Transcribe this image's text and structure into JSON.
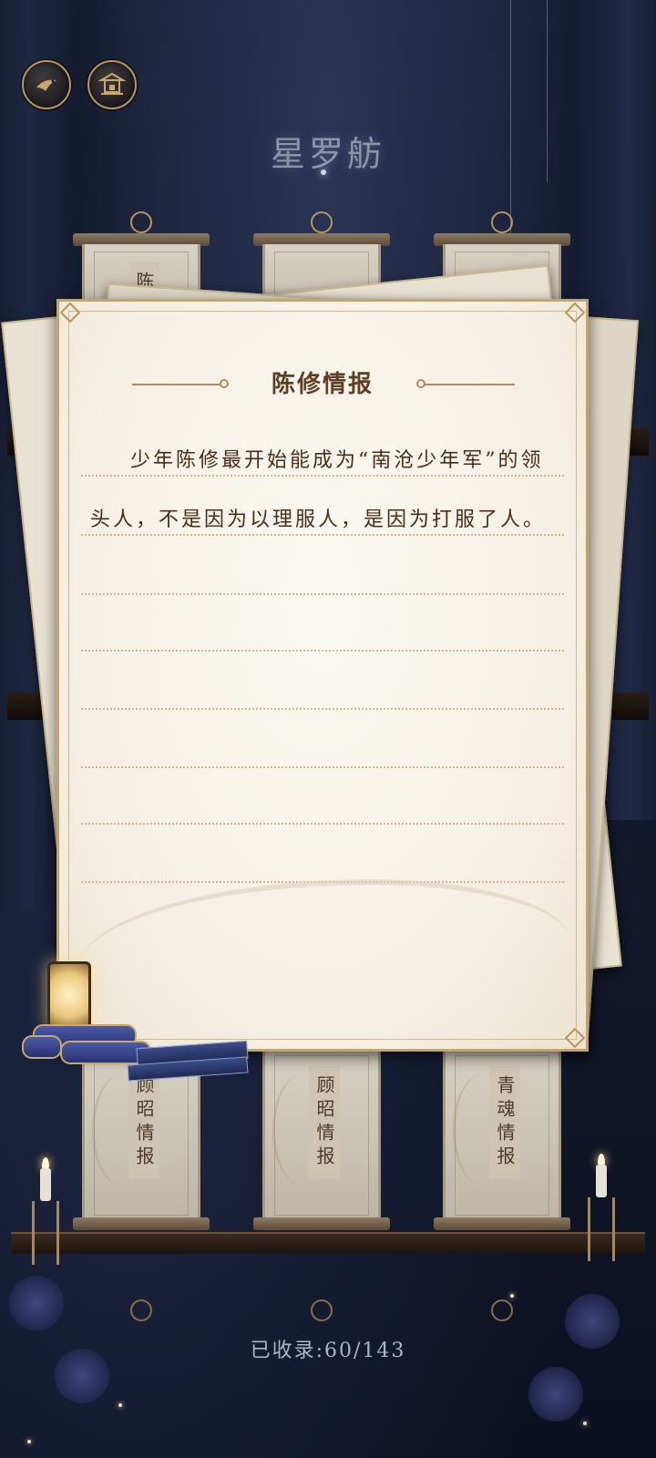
{
  "header": {
    "title": "星罗舫",
    "back_icon": "bird-icon",
    "pavilion_icon": "pavilion-icon"
  },
  "scrolls_top": [
    {
      "label": "陈"
    },
    {
      "label": ""
    },
    {
      "label": ""
    }
  ],
  "scrolls_bottom": [
    {
      "label": "顾昭情报"
    },
    {
      "label": "顾昭情报"
    },
    {
      "label": "青魂情报"
    }
  ],
  "dialog": {
    "title": "陈修情报",
    "body": "少年陈修最开始能成为“南沧少年军”的领头人，不是因为以理服人，是因为打服了人。"
  },
  "footer": {
    "collected": "已收录:60/143"
  },
  "colors": {
    "gold": "#b8955a",
    "paper": "#f7f3ea",
    "ink": "#4a2c18"
  }
}
